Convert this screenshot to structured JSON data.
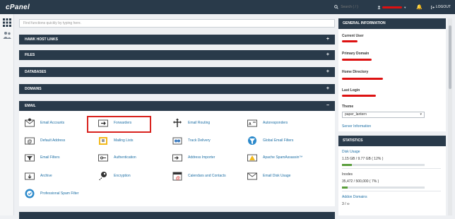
{
  "header": {
    "logo": "cPanel",
    "search_placeholder": "Search ( / )",
    "logout_label": "LOGOUT"
  },
  "quick_search": {
    "placeholder": "Find functions quickly by typing here."
  },
  "sections": [
    {
      "label": "HAWK HOST LINKS",
      "toggle": "+"
    },
    {
      "label": "FILES",
      "toggle": "+"
    },
    {
      "label": "DATABASES",
      "toggle": "+"
    },
    {
      "label": "DOMAINS",
      "toggle": "+"
    },
    {
      "label": "EMAIL",
      "toggle": "−"
    }
  ],
  "email_tools": [
    {
      "label": "Email Accounts",
      "icon": "email-accounts-icon"
    },
    {
      "label": "Forwarders",
      "icon": "forwarders-icon"
    },
    {
      "label": "Email Routing",
      "icon": "email-routing-icon"
    },
    {
      "label": "Autoresponders",
      "icon": "autoresponders-icon"
    },
    {
      "label": "Default Address",
      "icon": "default-address-icon"
    },
    {
      "label": "Mailing Lists",
      "icon": "mailing-lists-icon"
    },
    {
      "label": "Track Delivery",
      "icon": "track-delivery-icon"
    },
    {
      "label": "Global Email Filters",
      "icon": "global-email-filters-icon"
    },
    {
      "label": "Email Filters",
      "icon": "email-filters-icon"
    },
    {
      "label": "Authentication",
      "icon": "authentication-icon"
    },
    {
      "label": "Address Importer",
      "icon": "address-importer-icon"
    },
    {
      "label": "Apache SpamAssassin™",
      "icon": "spamassassin-icon"
    },
    {
      "label": "Archive",
      "icon": "archive-icon"
    },
    {
      "label": "Encryption",
      "icon": "encryption-icon"
    },
    {
      "label": "Calendars and Contacts",
      "icon": "calendars-contacts-icon"
    },
    {
      "label": "Email Disk Usage",
      "icon": "email-disk-usage-icon"
    },
    {
      "label": "Professional Spam Filter",
      "icon": "professional-spam-filter-icon"
    }
  ],
  "general_info": {
    "title": "GENERAL INFORMATION",
    "current_user_label": "Current User",
    "primary_domain_label": "Primary Domain",
    "home_directory_label": "Home Directory",
    "last_login_label": "Last Login",
    "theme_label": "Theme",
    "theme_value": "paper_lantern",
    "server_info_link": "Server Information"
  },
  "statistics": {
    "title": "STATISTICS",
    "disk_usage_label": "Disk Usage",
    "disk_usage_value": "1.15 GB / 9.77 GB ( 12% )",
    "disk_usage_fraction": 0.12,
    "inodes_label": "Inodes",
    "inodes_value": "35,472 / 500,000 ( 7% )",
    "inodes_fraction": 0.07,
    "addon_domains_label": "Addon Domains",
    "addon_domains_value": "3 / ∞"
  },
  "colors": {
    "topbar": "#293a4a",
    "link": "#1d6fa5",
    "highlight": "#d9231e",
    "redaction": "#dd1111",
    "progress": "#5a9e3c"
  }
}
